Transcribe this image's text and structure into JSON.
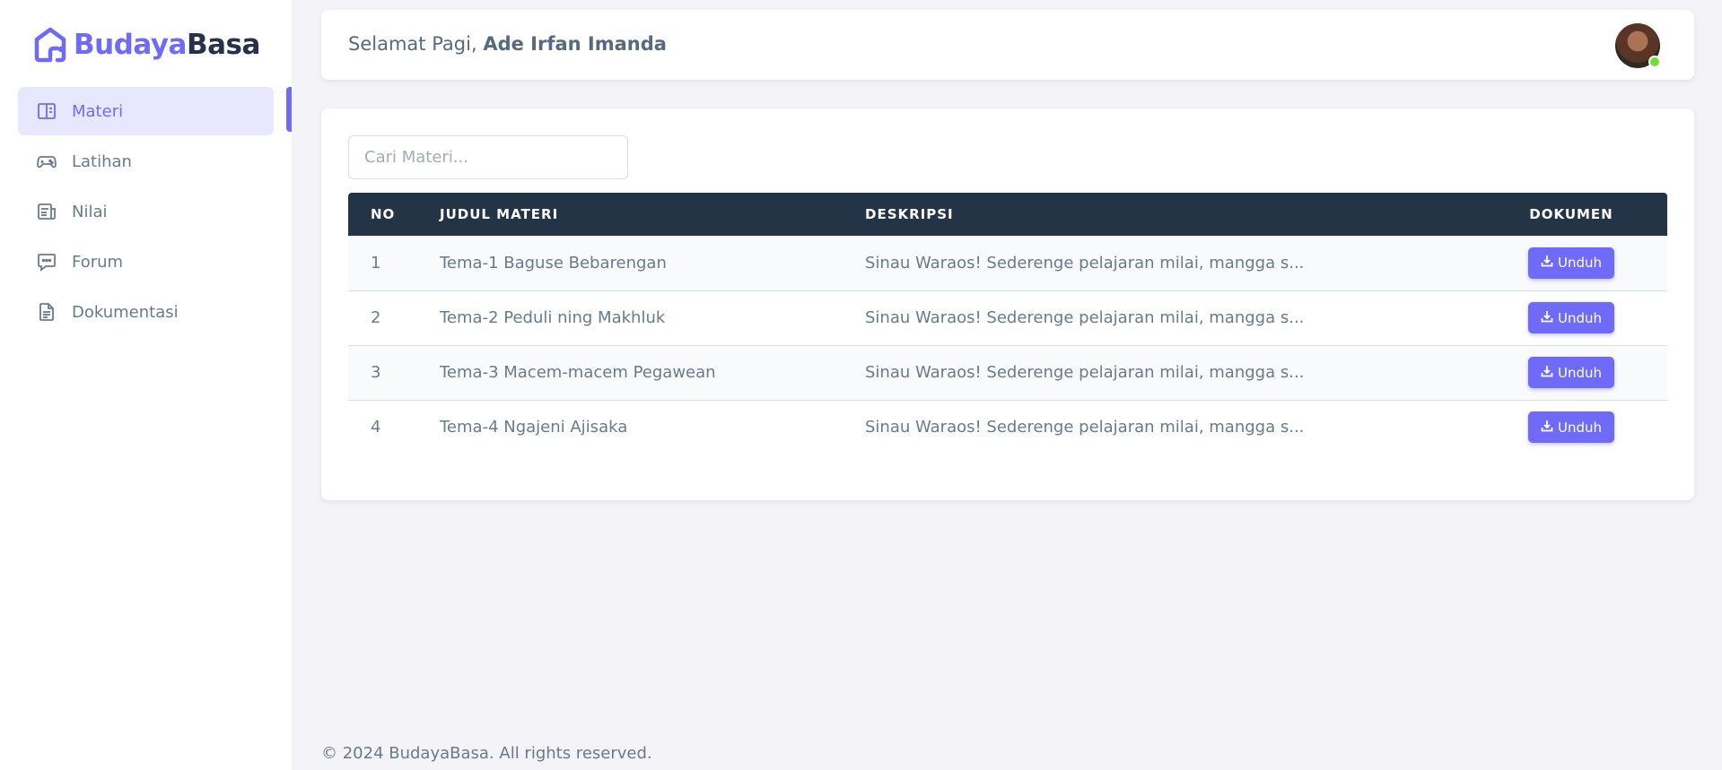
{
  "brand": {
    "part1": "Budaya",
    "part2": "Basa"
  },
  "sidebar": {
    "items": [
      {
        "label": "Materi",
        "icon": "book-open-icon",
        "active": true
      },
      {
        "label": "Latihan",
        "icon": "gamepad-icon",
        "active": false
      },
      {
        "label": "Nilai",
        "icon": "report-icon",
        "active": false
      },
      {
        "label": "Forum",
        "icon": "chat-icon",
        "active": false
      },
      {
        "label": "Dokumentasi",
        "icon": "file-icon",
        "active": false
      }
    ]
  },
  "header": {
    "greeting": "Selamat Pagi,",
    "user_name": "Ade Irfan Imanda"
  },
  "search": {
    "placeholder": "Cari Materi..."
  },
  "table": {
    "headers": {
      "no": "NO",
      "title": "JUDUL MATERI",
      "desc": "DESKRIPSI",
      "doc": "DOKUMEN"
    },
    "rows": [
      {
        "no": "1",
        "title": "Tema-1 Baguse Bebarengan",
        "desc": "Sinau Waraos! Sederenge pelajaran milai, mangga s...",
        "button": "Unduh"
      },
      {
        "no": "2",
        "title": "Tema-2 Peduli ning Makhluk",
        "desc": "Sinau Waraos! Sederenge pelajaran milai, mangga s...",
        "button": "Unduh"
      },
      {
        "no": "3",
        "title": "Tema-3 Macem-macem Pegawean",
        "desc": "Sinau Waraos! Sederenge pelajaran milai, mangga s...",
        "button": "Unduh"
      },
      {
        "no": "4",
        "title": "Tema-4 Ngajeni Ajisaka",
        "desc": "Sinau Waraos! Sederenge pelajaran milai, mangga s...",
        "button": "Unduh"
      }
    ]
  },
  "footer": {
    "text": "© 2024 BudayaBasa. All rights reserved."
  },
  "colors": {
    "accent": "#6f6af8",
    "table_header": "#233446",
    "online": "#71dd37"
  }
}
